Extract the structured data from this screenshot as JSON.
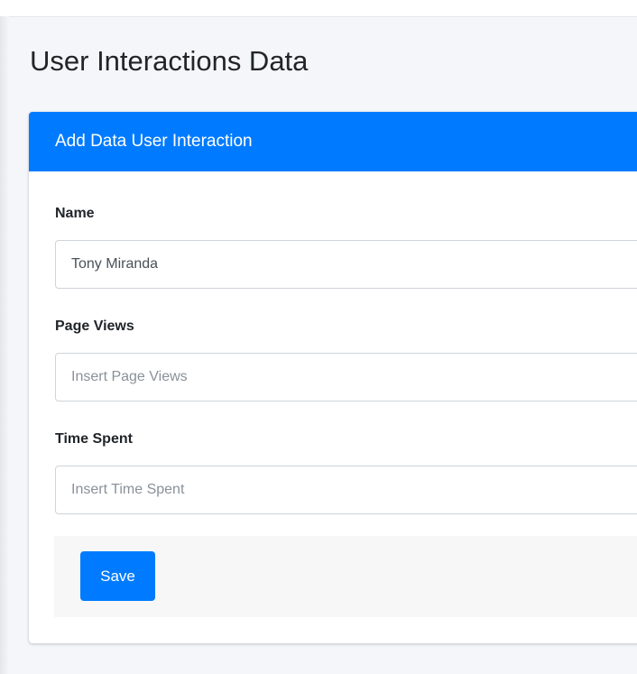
{
  "page": {
    "title": "User Interactions Data"
  },
  "card": {
    "header_title": "Add Data User Interaction",
    "fields": [
      {
        "label": "Name",
        "value": "Tony Miranda",
        "placeholder": ""
      },
      {
        "label": "Page Views",
        "value": "",
        "placeholder": "Insert Page Views"
      },
      {
        "label": "Time Spent",
        "value": "",
        "placeholder": "Insert Time Spent"
      }
    ],
    "save_label": "Save"
  },
  "colors": {
    "primary": "#007bff",
    "background": "#f4f6f9",
    "footer": "#f7f7f7"
  }
}
